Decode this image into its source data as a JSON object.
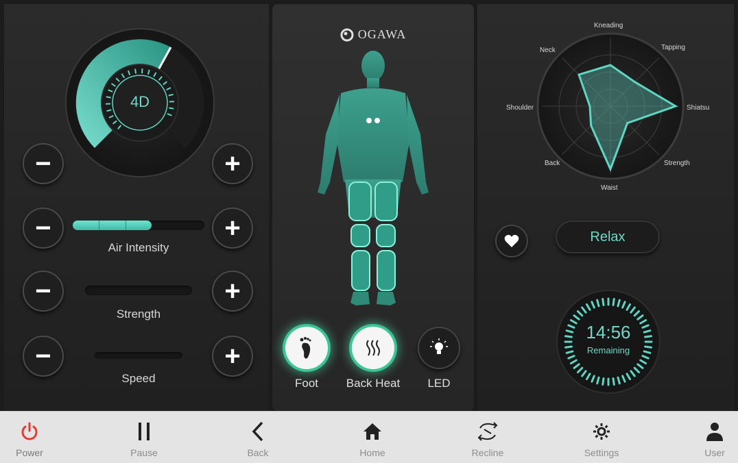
{
  "left": {
    "mode_dial": {
      "label": "4D",
      "level": 0.55
    },
    "air_intensity": {
      "label": "Air Intensity",
      "level": 0.6,
      "segments": 3
    },
    "strength": {
      "label": "Strength",
      "level": 0
    },
    "speed": {
      "label": "Speed",
      "level": 0
    }
  },
  "center": {
    "brand": "OGAWA",
    "features": [
      {
        "label": "Foot",
        "icon": "foot-icon",
        "active": true
      },
      {
        "label": "Back Heat",
        "icon": "heat-icon",
        "active": true
      },
      {
        "label": "LED",
        "icon": "bulb-icon",
        "active": false
      }
    ]
  },
  "right": {
    "radar": {
      "axes": [
        "Kneading",
        "Tapping",
        "Shiatsu",
        "Strength",
        "Waist",
        "Back",
        "Shoulder",
        "Neck"
      ],
      "values": [
        0.6,
        0.5,
        0.95,
        0.35,
        0.92,
        0.4,
        0.3,
        0.65
      ]
    },
    "program": "Relax",
    "timer": {
      "time": "14:56",
      "label": "Remaining"
    }
  },
  "bottom_bar": {
    "items": [
      {
        "label": "Power",
        "icon": "power-icon"
      },
      {
        "label": "Pause",
        "icon": "pause-icon"
      },
      {
        "label": "Back",
        "icon": "back-chevron-icon"
      },
      {
        "label": "Home",
        "icon": "home-icon"
      },
      {
        "label": "Recline",
        "icon": "recline-icon"
      },
      {
        "label": "Settings",
        "icon": "gear-icon"
      },
      {
        "label": "User",
        "icon": "user-icon"
      }
    ]
  },
  "colors": {
    "accent": "#5fd6c2",
    "power": "#e53935",
    "panel": "#262626",
    "bar": "#e4e4e4"
  }
}
